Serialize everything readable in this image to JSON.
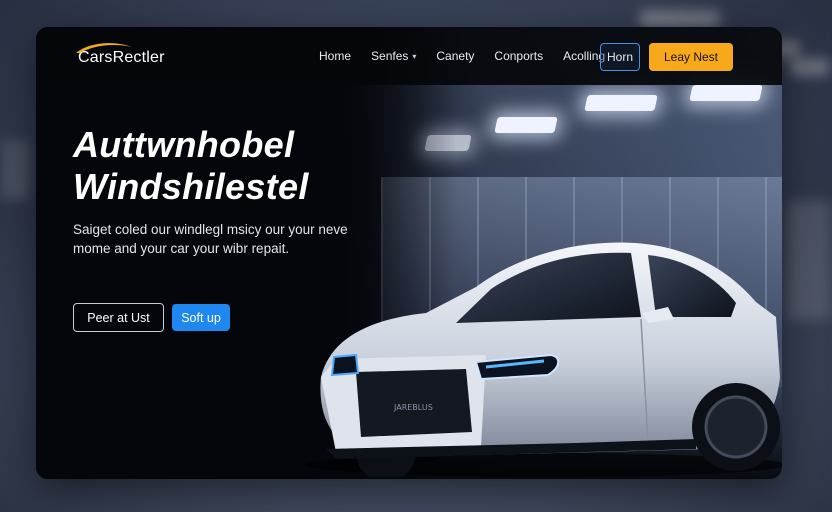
{
  "brand": {
    "name": "CarsRectler"
  },
  "nav": {
    "items": [
      {
        "label": "Home",
        "has_dropdown": false
      },
      {
        "label": "Senfes",
        "has_dropdown": true
      },
      {
        "label": "Canety",
        "has_dropdown": false
      },
      {
        "label": "Conports",
        "has_dropdown": false
      },
      {
        "label": "Acolling",
        "has_dropdown": false
      }
    ],
    "outline_button": "Horn",
    "cta_button": "Leay Nest"
  },
  "hero": {
    "headline_line1": "Auttwnhobel",
    "headline_line2": "Windshilestel",
    "subtext_line1": "Saiget coled our windlegl msicy our your neve",
    "subtext_line2": "mome and your car your wibr repait.",
    "primary_button": "Peer at Ust",
    "secondary_button": "Soft up",
    "car_badge": "JAREBLUS"
  },
  "colors": {
    "accent_orange": "#f7a81b",
    "accent_blue": "#1e88f0",
    "outline_blue": "#4a90e2",
    "background_dark": "#05070c"
  },
  "icons": {
    "logo": "swoosh-logo-icon",
    "dropdown": "chevron-down-icon"
  }
}
